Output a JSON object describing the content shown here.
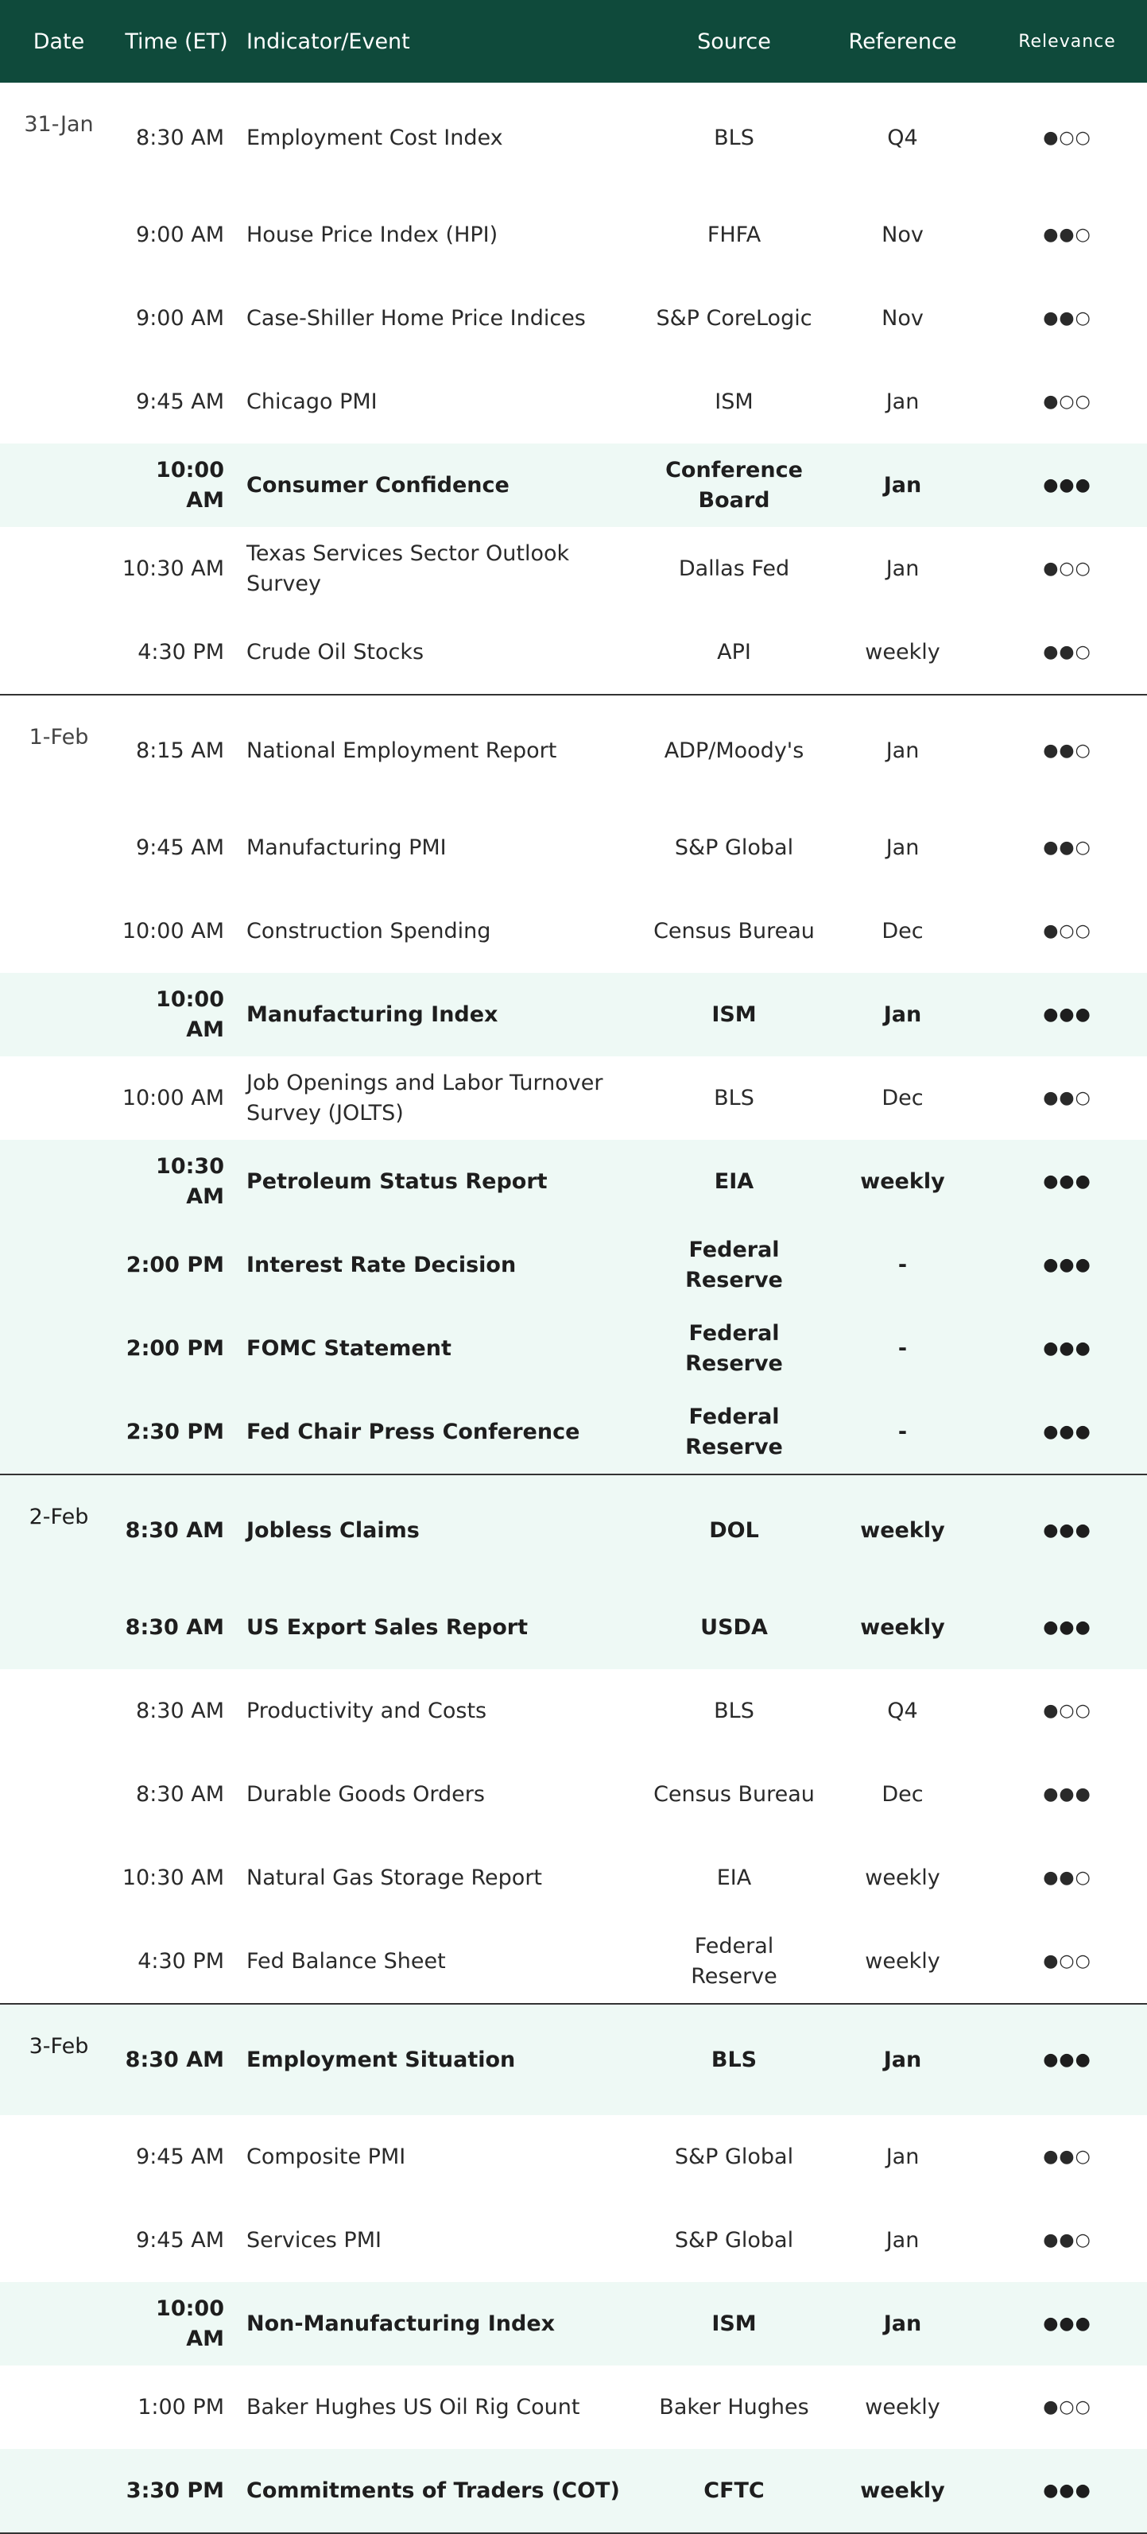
{
  "headers": {
    "date": "Date",
    "time": "Time (ET)",
    "indicator": "Indicator/Event",
    "source": "Source",
    "reference": "Reference",
    "relevance": "Relevance"
  },
  "rows": [
    {
      "date": "31-Jan",
      "time": "8:30 AM",
      "indicator": "Employment Cost Index",
      "source": "BLS",
      "reference": "Q4",
      "relevance": "●○○",
      "highlight": false,
      "sep": false
    },
    {
      "date": "",
      "time": "9:00 AM",
      "indicator": "House Price Index (HPI)",
      "source": "FHFA",
      "reference": "Nov",
      "relevance": "●●○",
      "highlight": false,
      "sep": false
    },
    {
      "date": "",
      "time": "9:00 AM",
      "indicator": "Case-Shiller Home Price Indices",
      "source": "S&P CoreLogic",
      "reference": "Nov",
      "relevance": "●●○",
      "highlight": false,
      "sep": false
    },
    {
      "date": "",
      "time": "9:45 AM",
      "indicator": "Chicago PMI",
      "source": "ISM",
      "reference": "Jan",
      "relevance": "●○○",
      "highlight": false,
      "sep": false
    },
    {
      "date": "",
      "time": "10:00 AM",
      "indicator": "Consumer Confidence",
      "source": "Conference Board",
      "reference": "Jan",
      "relevance": "●●●",
      "highlight": true,
      "sep": false
    },
    {
      "date": "",
      "time": "10:30 AM",
      "indicator": "Texas Services Sector Outlook Survey",
      "source": "Dallas Fed",
      "reference": "Jan",
      "relevance": "●○○",
      "highlight": false,
      "sep": false
    },
    {
      "date": "",
      "time": "4:30 PM",
      "indicator": "Crude Oil Stocks",
      "source": "API",
      "reference": "weekly",
      "relevance": "●●○",
      "highlight": false,
      "sep": true
    },
    {
      "date": "1-Feb",
      "time": "8:15 AM",
      "indicator": "National Employment Report",
      "source": "ADP/Moody's",
      "reference": "Jan",
      "relevance": "●●○",
      "highlight": false,
      "sep": false
    },
    {
      "date": "",
      "time": "9:45 AM",
      "indicator": "Manufacturing PMI",
      "source": "S&P Global",
      "reference": "Jan",
      "relevance": "●●○",
      "highlight": false,
      "sep": false
    },
    {
      "date": "",
      "time": "10:00 AM",
      "indicator": "Construction Spending",
      "source": "Census Bureau",
      "reference": "Dec",
      "relevance": "●○○",
      "highlight": false,
      "sep": false
    },
    {
      "date": "",
      "time": "10:00 AM",
      "indicator": "Manufacturing Index",
      "source": "ISM",
      "reference": "Jan",
      "relevance": "●●●",
      "highlight": true,
      "sep": false
    },
    {
      "date": "",
      "time": "10:00 AM",
      "indicator": "Job Openings and Labor Turnover Survey (JOLTS)",
      "source": "BLS",
      "reference": "Dec",
      "relevance": "●●○",
      "highlight": false,
      "sep": false
    },
    {
      "date": "",
      "time": "10:30 AM",
      "indicator": "Petroleum Status Report",
      "source": "EIA",
      "reference": "weekly",
      "relevance": "●●●",
      "highlight": true,
      "sep": false
    },
    {
      "date": "",
      "time": "2:00 PM",
      "indicator": "Interest Rate Decision",
      "source": "Federal Reserve",
      "reference": "-",
      "relevance": "●●●",
      "highlight": true,
      "sep": false
    },
    {
      "date": "",
      "time": "2:00 PM",
      "indicator": "FOMC Statement",
      "source": "Federal Reserve",
      "reference": "-",
      "relevance": "●●●",
      "highlight": true,
      "sep": false
    },
    {
      "date": "",
      "time": "2:30 PM",
      "indicator": "Fed Chair Press Conference",
      "source": "Federal Reserve",
      "reference": "-",
      "relevance": "●●●",
      "highlight": true,
      "sep": true
    },
    {
      "date": "2-Feb",
      "time": "8:30 AM",
      "indicator": "Jobless Claims",
      "source": "DOL",
      "reference": "weekly",
      "relevance": "●●●",
      "highlight": true,
      "sep": false
    },
    {
      "date": "",
      "time": "8:30 AM",
      "indicator": "US Export Sales Report",
      "source": "USDA",
      "reference": "weekly",
      "relevance": "●●●",
      "highlight": true,
      "sep": false
    },
    {
      "date": "",
      "time": "8:30 AM",
      "indicator": "Productivity and Costs",
      "source": "BLS",
      "reference": "Q4",
      "relevance": "●○○",
      "highlight": false,
      "sep": false
    },
    {
      "date": "",
      "time": "8:30 AM",
      "indicator": "Durable Goods Orders",
      "source": "Census Bureau",
      "reference": "Dec",
      "relevance": "●●●",
      "highlight": false,
      "sep": false
    },
    {
      "date": "",
      "time": "10:30 AM",
      "indicator": "Natural Gas Storage Report",
      "source": "EIA",
      "reference": "weekly",
      "relevance": "●●○",
      "highlight": false,
      "sep": false
    },
    {
      "date": "",
      "time": "4:30 PM",
      "indicator": "Fed Balance Sheet",
      "source": "Federal Reserve",
      "reference": "weekly",
      "relevance": "●○○",
      "highlight": false,
      "sep": true
    },
    {
      "date": "3-Feb",
      "time": "8:30 AM",
      "indicator": "Employment Situation",
      "source": "BLS",
      "reference": "Jan",
      "relevance": "●●●",
      "highlight": true,
      "sep": false
    },
    {
      "date": "",
      "time": "9:45 AM",
      "indicator": "Composite PMI",
      "source": "S&P Global",
      "reference": "Jan",
      "relevance": "●●○",
      "highlight": false,
      "sep": false
    },
    {
      "date": "",
      "time": "9:45 AM",
      "indicator": "Services PMI",
      "source": "S&P Global",
      "reference": "Jan",
      "relevance": "●●○",
      "highlight": false,
      "sep": false
    },
    {
      "date": "",
      "time": "10:00 AM",
      "indicator": "Non-Manufacturing Index",
      "source": "ISM",
      "reference": "Jan",
      "relevance": "●●●",
      "highlight": true,
      "sep": false
    },
    {
      "date": "",
      "time": "1:00 PM",
      "indicator": "Baker Hughes US Oil Rig Count",
      "source": "Baker Hughes",
      "reference": "weekly",
      "relevance": "●○○",
      "highlight": false,
      "sep": false
    },
    {
      "date": "",
      "time": "3:30 PM",
      "indicator": "Commitments of Traders (COT)",
      "source": "CFTC",
      "reference": "weekly",
      "relevance": "●●●",
      "highlight": true,
      "sep": true
    }
  ]
}
